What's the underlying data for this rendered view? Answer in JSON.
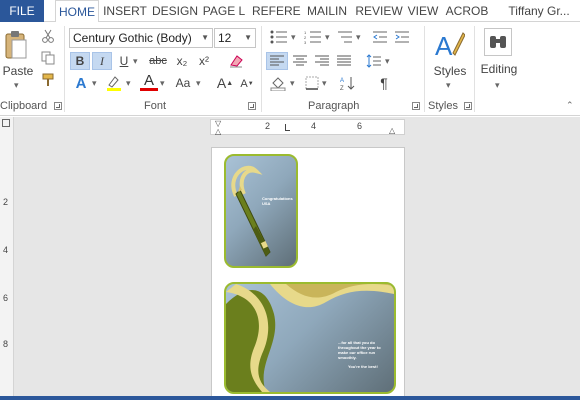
{
  "tabs": {
    "file": "FILE",
    "home": "HOME",
    "insert": "INSERT",
    "design": "DESIGN",
    "page_layout": "PAGE L",
    "references": "REFERE",
    "mailings": "MAILIN",
    "review": "REVIEW",
    "view": "VIEW",
    "acrobat": "ACROB",
    "user": "Tiffany Gr..."
  },
  "clipboard": {
    "paste_label": "Paste",
    "group_label": "Clipboard"
  },
  "font": {
    "family": "Century Gothic (Body)",
    "size": "12",
    "group_label": "Font",
    "bold": "B",
    "italic": "I",
    "underline": "U",
    "strike": "abc",
    "subscript": "x₂",
    "superscript": "x²",
    "text_effects": "A",
    "font_color": "A",
    "case": "Aa"
  },
  "paragraph": {
    "group_label": "Paragraph",
    "pilcrow": "¶"
  },
  "styles": {
    "button_label": "Styles",
    "group_label": "Styles"
  },
  "editing": {
    "button_label": "Editing"
  },
  "hruler": {
    "n2": "2",
    "n4": "4",
    "n6": "6"
  },
  "vruler": {
    "n2": "2",
    "n4": "4",
    "n6": "6",
    "n8": "8"
  },
  "card_small": {
    "text": "Congratulations USA"
  },
  "card_large": {
    "text": "...for all that you do throughout the year to make our office run smoothly.",
    "closing": "You're the best!"
  },
  "colors": {
    "accent": "#2b579a",
    "card_border": "#9bbb2f",
    "card_green": "#6b7f1d",
    "card_cream": "#e7d98a"
  }
}
